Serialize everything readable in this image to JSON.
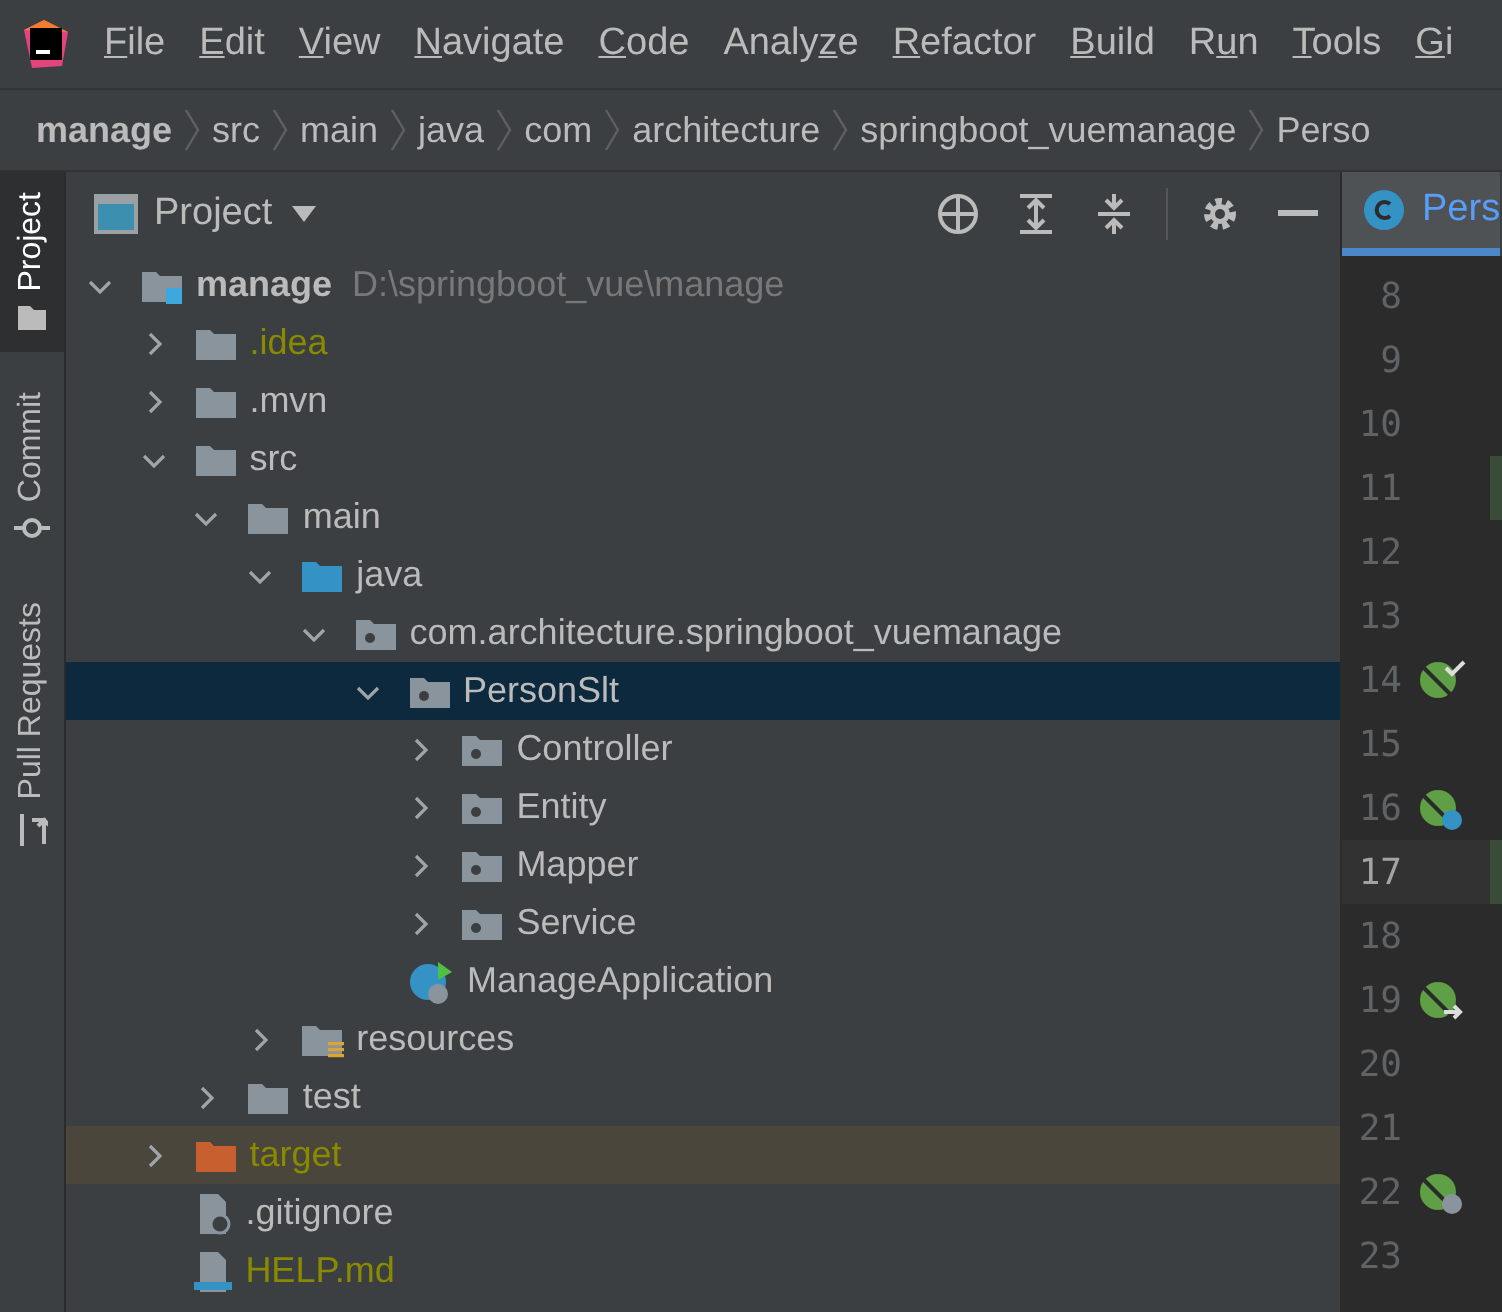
{
  "menu": [
    {
      "mnemonic": "F",
      "after": "ile"
    },
    {
      "mnemonic": "E",
      "after": "dit"
    },
    {
      "mnemonic": "V",
      "after": "iew"
    },
    {
      "mnemonic": "N",
      "after": "avigate"
    },
    {
      "mnemonic": "C",
      "after": "ode"
    },
    {
      "before": "Analy",
      "mnemonic": "z",
      "after": "e"
    },
    {
      "mnemonic": "R",
      "after": "efactor"
    },
    {
      "mnemonic": "B",
      "after": "uild"
    },
    {
      "before": "R",
      "mnemonic": "u",
      "after": "n"
    },
    {
      "mnemonic": "T",
      "after": "ools"
    },
    {
      "mnemonic": "G",
      "after": "i"
    }
  ],
  "breadcrumb": [
    "manage",
    "src",
    "main",
    "java",
    "com",
    "architecture",
    "springboot_vuemanage",
    "Perso"
  ],
  "side_tabs": [
    {
      "label": "Project",
      "kind": "project",
      "selected": true
    },
    {
      "label": "Commit",
      "kind": "commit",
      "selected": false
    },
    {
      "label": "Pull Requests",
      "kind": "pull",
      "selected": false
    }
  ],
  "project_panel": {
    "title": "Project"
  },
  "tree": [
    {
      "name": "manage",
      "path": "D:\\springboot_vue\\manage",
      "kind": "module",
      "ignored": false,
      "expanded": true,
      "selected": false,
      "children": [
        {
          "name": ".idea",
          "kind": "folder",
          "ignored": true,
          "expanded": false,
          "selected": false
        },
        {
          "name": ".mvn",
          "kind": "folder",
          "ignored": false,
          "expanded": false,
          "selected": false
        },
        {
          "name": "src",
          "kind": "folder",
          "ignored": false,
          "expanded": true,
          "selected": false,
          "children": [
            {
              "name": "main",
              "kind": "folder",
              "ignored": false,
              "expanded": true,
              "selected": false,
              "children": [
                {
                  "name": "java",
                  "kind": "source",
                  "ignored": false,
                  "expanded": true,
                  "selected": false,
                  "children": [
                    {
                      "name": "com.architecture.springboot_vuemanage",
                      "kind": "package",
                      "ignored": false,
                      "expanded": true,
                      "selected": false,
                      "children": [
                        {
                          "name": "PersonSlt",
                          "kind": "package",
                          "ignored": false,
                          "expanded": true,
                          "selected": true,
                          "children": [
                            {
                              "name": "Controller",
                              "kind": "package",
                              "ignored": false,
                              "expanded": false,
                              "selected": false
                            },
                            {
                              "name": "Entity",
                              "kind": "package",
                              "ignored": false,
                              "expanded": false,
                              "selected": false
                            },
                            {
                              "name": "Mapper",
                              "kind": "package",
                              "ignored": false,
                              "expanded": false,
                              "selected": false
                            },
                            {
                              "name": "Service",
                              "kind": "package",
                              "ignored": false,
                              "expanded": false,
                              "selected": false
                            }
                          ]
                        },
                        {
                          "name": "ManageApplication",
                          "kind": "app-class",
                          "ignored": false,
                          "selected": false
                        }
                      ]
                    }
                  ]
                },
                {
                  "name": "resources",
                  "kind": "resources",
                  "ignored": false,
                  "expanded": false,
                  "selected": false
                }
              ]
            },
            {
              "name": "test",
              "kind": "folder",
              "ignored": false,
              "expanded": false,
              "selected": false
            }
          ]
        },
        {
          "name": "target",
          "kind": "excluded",
          "ignored": true,
          "expanded": false,
          "selected": false
        },
        {
          "name": ".gitignore",
          "kind": "ignore-file",
          "ignored": false,
          "selected": false
        },
        {
          "name": "HELP.md",
          "kind": "markdown",
          "ignored": true,
          "selected": false
        }
      ]
    }
  ],
  "editor_tab": {
    "label": "Pers",
    "selected": true
  },
  "gutter": [
    {
      "number": "8",
      "current": false
    },
    {
      "number": "9",
      "current": false
    },
    {
      "number": "10",
      "current": false
    },
    {
      "number": "11",
      "current": false,
      "changed": true
    },
    {
      "number": "12",
      "current": false
    },
    {
      "number": "13",
      "current": false
    },
    {
      "number": "14",
      "current": false,
      "kind": "check"
    },
    {
      "number": "15",
      "current": false
    },
    {
      "number": "16",
      "current": false,
      "kind": "class"
    },
    {
      "number": "17",
      "current": true,
      "changed": true
    },
    {
      "number": "18",
      "current": false
    },
    {
      "number": "19",
      "current": false,
      "kind": "arrow"
    },
    {
      "number": "20",
      "current": false
    },
    {
      "number": "21",
      "current": false
    },
    {
      "number": "22",
      "current": false,
      "kind": "globe"
    },
    {
      "number": "23",
      "current": false
    }
  ]
}
